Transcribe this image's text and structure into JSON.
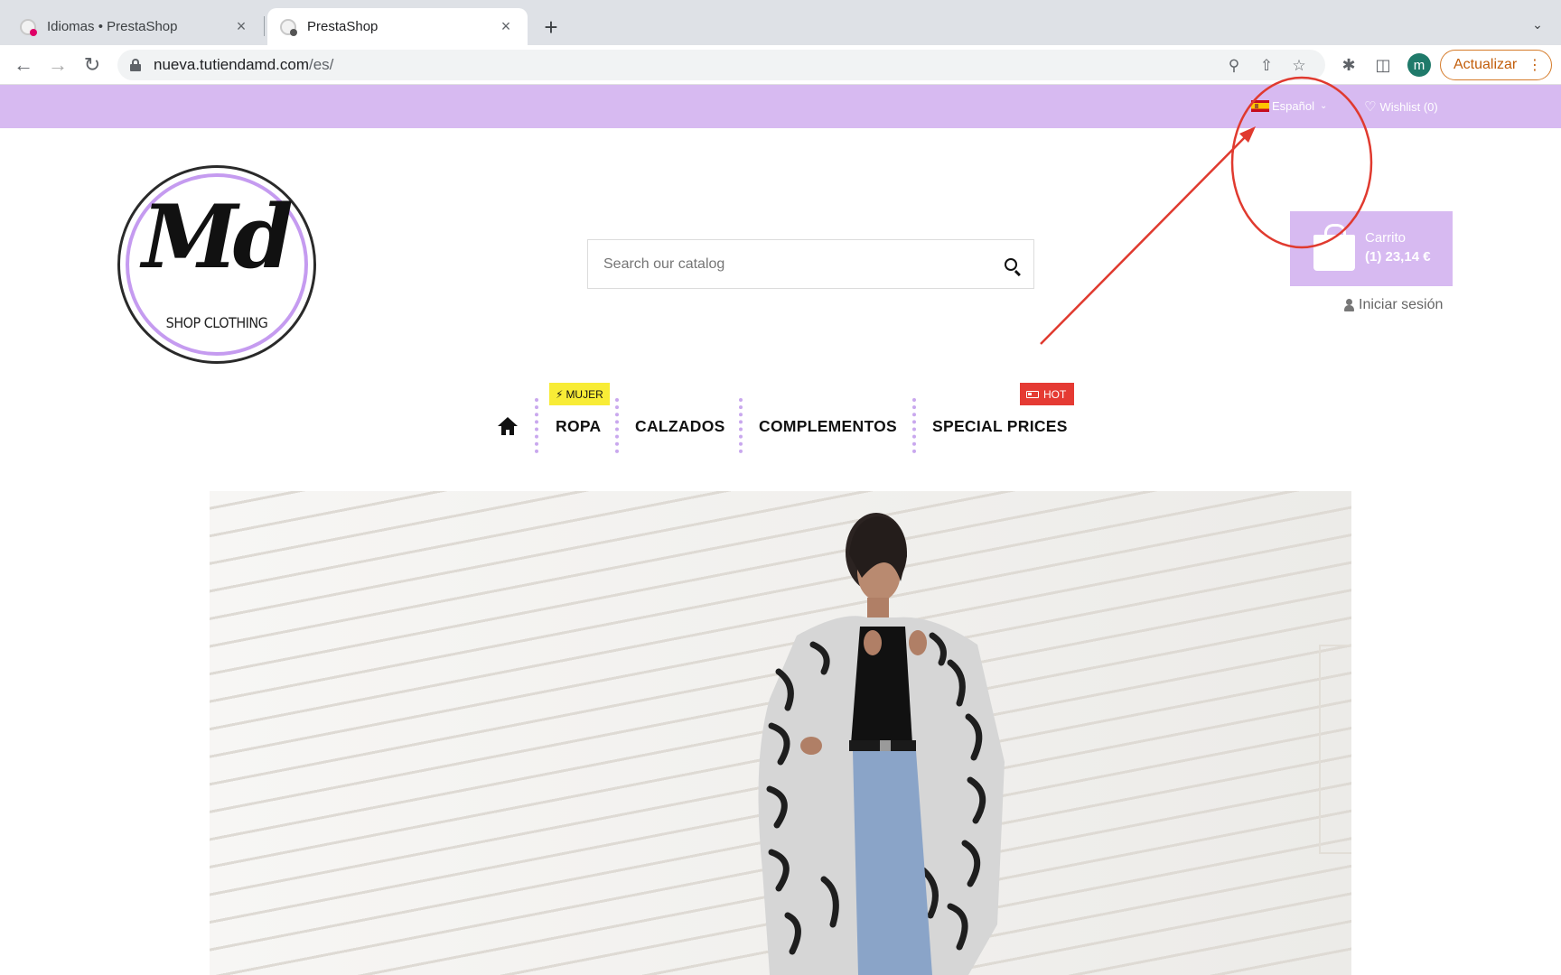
{
  "browser": {
    "tabs": [
      {
        "title": "Idiomas • PrestaShop",
        "active": false
      },
      {
        "title": "PrestaShop",
        "active": true
      }
    ],
    "close_glyph": "×",
    "newtab_glyph": "+",
    "url_host": "nueva.tutiendamd.com",
    "url_path": "/es/",
    "profile_initial": "m",
    "update_label": "Actualizar"
  },
  "topbar": {
    "language": "Español",
    "wishlist": "Wishlist (0)",
    "color": "#d7baf1"
  },
  "logo": {
    "mark": "Md",
    "subtitle": "SHOP CLOTHING"
  },
  "search": {
    "placeholder": "Search our catalog"
  },
  "cart": {
    "label": "Carrito",
    "total": "(1) 23,14 €"
  },
  "account": {
    "login": "Iniciar sesión"
  },
  "menu": {
    "items": [
      "ROPA",
      "CALZADOS",
      "COMPLEMENTOS",
      "SPECIAL PRICES"
    ],
    "badge_mujer": "MUJER",
    "badge_hot": "HOT"
  },
  "annotation": {
    "color": "#e03a2f"
  }
}
